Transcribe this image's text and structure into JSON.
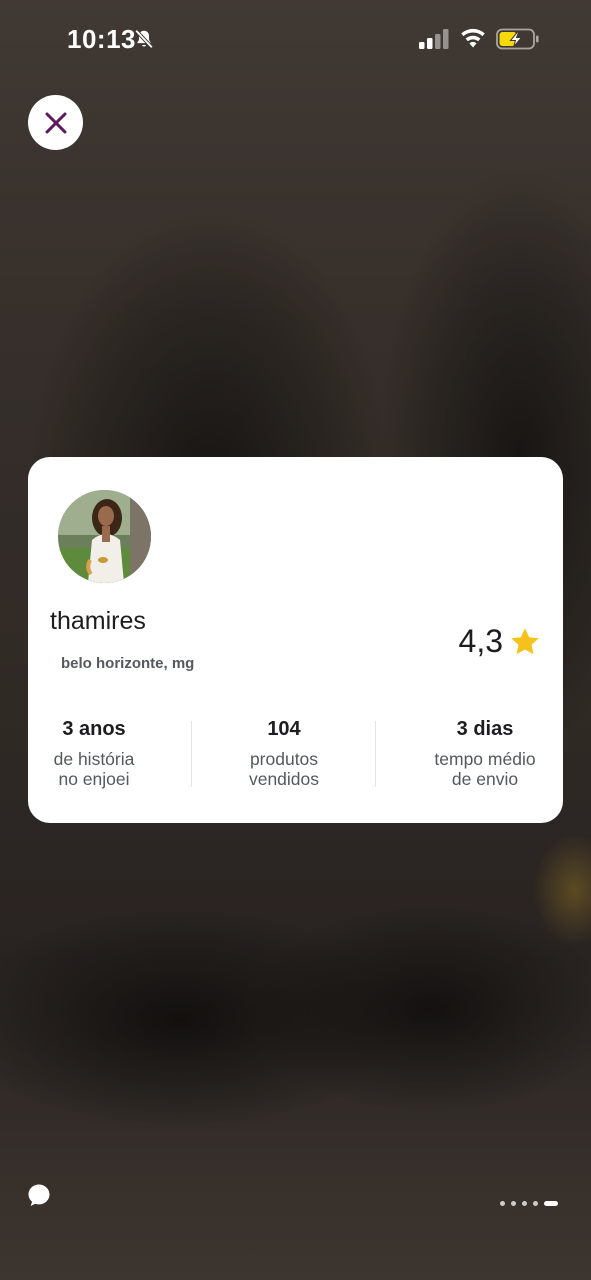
{
  "status_bar": {
    "time": "10:13",
    "icons": [
      "bell-slash-icon",
      "cellular-signal-icon",
      "wifi-icon",
      "battery-charging-icon"
    ]
  },
  "close_button": {
    "icon": "close-icon",
    "color": "#5c1a5e"
  },
  "profile": {
    "avatar": "avatar",
    "name": "thamires",
    "location": "belo horizonte, mg",
    "rating": "4,3",
    "rating_icon": "star-icon",
    "star_color": "#f6c11b"
  },
  "stats": [
    {
      "value": "3 anos",
      "line1": "de história",
      "line2": "no enjoei"
    },
    {
      "value": "104",
      "line1": "produtos",
      "line2": "vendidos"
    },
    {
      "value": "3 dias",
      "line1": "tempo médio",
      "line2": "de envio"
    }
  ],
  "bottom": {
    "chat_icon": "chat-bubble-icon",
    "page_indicator": {
      "total": 5,
      "current": 5
    }
  }
}
